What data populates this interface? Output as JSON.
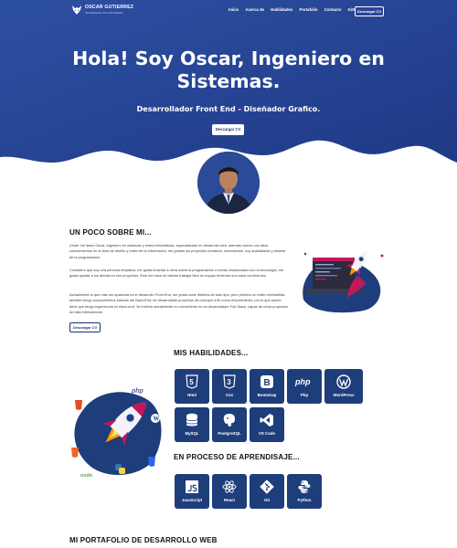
{
  "brand": {
    "name": "OSCAR GUTIERREZ",
    "tagline": "INGENIERO EN SISTEMAS"
  },
  "nav": {
    "links": [
      "Inicio",
      "Acerca de",
      "Habilidades",
      "Portafolio",
      "Contacto",
      "GitHub"
    ],
    "cv_button": "Descargar CV"
  },
  "hero": {
    "title_line1": "Hola! Soy Oscar, Ingeniero en",
    "title_line2": "Sistemas.",
    "subtitle": "Desarrollador Front End - Diseñador Grafico.",
    "button": "Descargar CV"
  },
  "about": {
    "heading": "UN POCO SOBRE MI...",
    "p1": "¡Hola! me llamo Oscar, ingeniero en sistemas y redes informáticas, especializado en desarrollo web, además cuento con altos conocimientos en el área de diseño y redes de la información; me gustan los proyectos creativos, innovadores, soy autodidacta y amante de la programación.",
    "p2": "Considero que soy una persona empática, me gusta enseñar a otros sobre la programación o temas relacionados con la tecnología, me gusta ayudar a los demás en sus proyectos. Esto me hace un talento trabajar bien en equipo teniendo una sana convivencia.",
    "p3": "Actualmente lo que más me apasiona es el desarrollo Front End, me gusta crear diseños de todo tipo, pero prefiero un estilo minimalista. también tengo conocimientos básicos del Back-End, he desarrollado proyectos de principio a fin como emprendedor; por lo que puedo decir que tengo experiencia en Back-end. Yo Invierto actualmente en convertirme en un desarrollador Full-Stack, capaz de crear proyectos de talla internacional.",
    "button": "Descargar CV"
  },
  "skills": {
    "heading": "MIS HABILIDADES...",
    "items": [
      {
        "label": "Html",
        "icon": "html5-icon"
      },
      {
        "label": "Css",
        "icon": "css3-icon"
      },
      {
        "label": "Bootstrap",
        "icon": "bootstrap-icon"
      },
      {
        "label": "Php",
        "icon": "php-icon"
      },
      {
        "label": "WordPress",
        "icon": "wordpress-icon"
      },
      {
        "label": "MySQL",
        "icon": "database-icon"
      },
      {
        "label": "PostgreSQL",
        "icon": "postgresql-icon"
      },
      {
        "label": "VS Code",
        "icon": "vscode-icon"
      }
    ]
  },
  "learning": {
    "heading": "EN PROCESO DE APRENDISAJE...",
    "items": [
      {
        "label": "JavaScript",
        "icon": "javascript-icon"
      },
      {
        "label": "React",
        "icon": "react-icon"
      },
      {
        "label": "Git",
        "icon": "git-icon"
      },
      {
        "label": "Python",
        "icon": "python-icon"
      }
    ]
  },
  "portfolio": {
    "heading": "MI PORTAFOLIO DE DESARROLLO WEB"
  },
  "icon_glyphs": {
    "bootstrap": "B",
    "php": "php",
    "html5": "5",
    "css3": "3",
    "illus_php": "php",
    "illus_node": "node"
  },
  "colors": {
    "primary": "#1e3d7b",
    "hero": "#2a4597",
    "accent": "#c2185b"
  }
}
